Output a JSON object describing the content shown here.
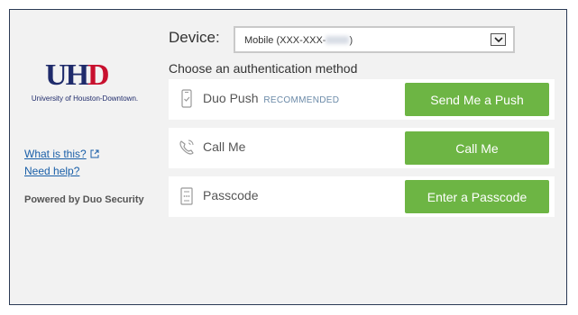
{
  "logo": {
    "mark_u": "U",
    "mark_h": "H",
    "mark_d": "D",
    "caption": "University of Houston-Downtown."
  },
  "sidebar": {
    "what_is_this": "What is this?",
    "need_help": "Need help?",
    "powered_by": "Powered by Duo Security"
  },
  "device": {
    "label": "Device:",
    "selected": "Mobile (XXX-XXX-",
    "selected_suffix": ")"
  },
  "choose_label": "Choose an authentication method",
  "methods": [
    {
      "label": "Duo Push",
      "badge": "RECOMMENDED",
      "button": "Send Me a Push",
      "icon": "phone-push-icon"
    },
    {
      "label": "Call Me",
      "badge": "",
      "button": "Call Me",
      "icon": "phone-call-icon"
    },
    {
      "label": "Passcode",
      "badge": "",
      "button": "Enter a Passcode",
      "icon": "passcode-icon"
    }
  ],
  "colors": {
    "button_green": "#6db544",
    "brand_navy": "#1f2b6b",
    "brand_red": "#c8102e",
    "link_blue": "#1a5fa8",
    "panel_bg": "#f2f2f2"
  }
}
